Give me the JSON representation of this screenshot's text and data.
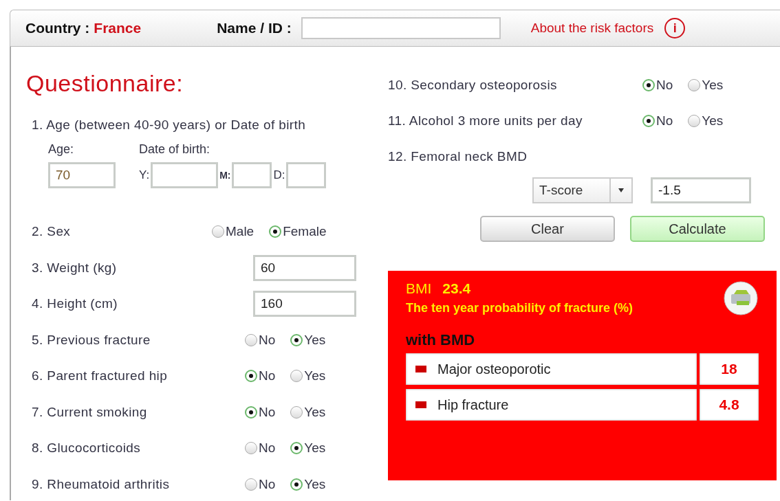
{
  "header": {
    "country_label": "Country :",
    "country": "France",
    "name_label": "Name / ID :",
    "about_link": "About the risk factors",
    "info_icon": "i"
  },
  "title": "Questionnaire:",
  "left_questions": [
    {
      "kind": "date",
      "label": "1. Age (between 40-90 years) or Date of birth",
      "age_label": "Age:",
      "age_value": "70",
      "dob_label": "Date of birth:",
      "parts": [
        {
          "label": "Y:"
        },
        {
          "label": "M:"
        },
        {
          "label": "D:"
        }
      ]
    },
    {
      "kind": "radio",
      "label": "2. Sex",
      "options": [
        {
          "label": "Male",
          "selected": false
        },
        {
          "label": "Female",
          "selected": true
        }
      ]
    },
    {
      "kind": "input",
      "label": "3. Weight (kg)",
      "value": "60"
    },
    {
      "kind": "input",
      "label": "4. Height (cm)",
      "value": "160"
    },
    {
      "kind": "radio",
      "label": "5. Previous fracture",
      "options": [
        {
          "label": "No",
          "selected": false
        },
        {
          "label": "Yes",
          "selected": true
        }
      ]
    },
    {
      "kind": "radio",
      "label": "6. Parent fractured hip",
      "options": [
        {
          "label": "No",
          "selected": true
        },
        {
          "label": "Yes",
          "selected": false
        }
      ]
    },
    {
      "kind": "radio",
      "label": "7. Current smoking",
      "options": [
        {
          "label": "No",
          "selected": true
        },
        {
          "label": "Yes",
          "selected": false
        }
      ]
    },
    {
      "kind": "radio",
      "label": "8. Glucocorticoids",
      "options": [
        {
          "label": "No",
          "selected": false
        },
        {
          "label": "Yes",
          "selected": true
        }
      ]
    },
    {
      "kind": "radio",
      "label": "9. Rheumatoid arthritis",
      "options": [
        {
          "label": "No",
          "selected": false
        },
        {
          "label": "Yes",
          "selected": true
        }
      ]
    }
  ],
  "right_questions": [
    {
      "kind": "radio",
      "label": "10. Secondary osteoporosis",
      "options": [
        {
          "label": "No",
          "selected": true
        },
        {
          "label": "Yes",
          "selected": false
        }
      ]
    },
    {
      "kind": "radio",
      "label": "11. Alcohol 3 more units per day",
      "options": [
        {
          "label": "No",
          "selected": true
        },
        {
          "label": "Yes",
          "selected": false
        }
      ]
    },
    {
      "kind": "bmd",
      "label": "12. Femoral neck BMD",
      "select": "T-score",
      "value": "-1.5"
    }
  ],
  "buttons": [
    {
      "label": "Clear",
      "kind": "clear"
    },
    {
      "label": "Calculate",
      "kind": "calculate"
    }
  ],
  "results": {
    "bmi_label": "BMI",
    "bmi_value": "23.4",
    "title": "The ten year probability of fracture (%)",
    "section": "with BMD",
    "rows": [
      {
        "label": "Major osteoporotic",
        "value": "18"
      },
      {
        "label": "Hip fracture",
        "value": "4.8"
      }
    ]
  }
}
